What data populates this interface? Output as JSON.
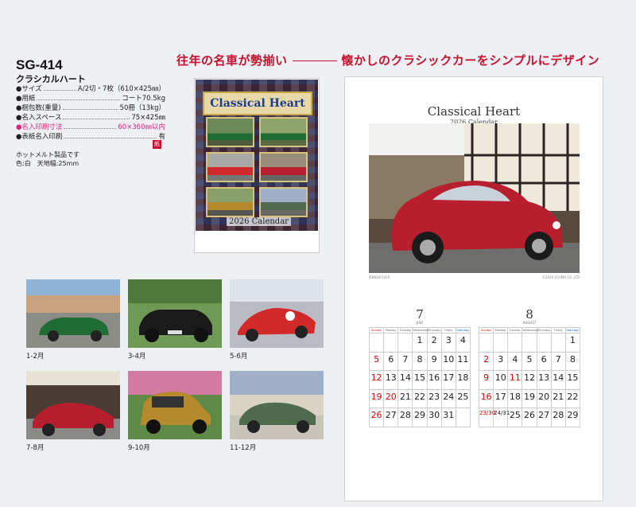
{
  "headline": {
    "left": "往年の名車が勢揃い",
    "right": "懐かしのクラシックカーをシンプルにデザイン"
  },
  "product": {
    "code": "SG-414",
    "name": "クラシカルハート",
    "specs": [
      {
        "label": "●サイズ",
        "value": "A/2切・7枚（610×425㎜）",
        "highlight": false
      },
      {
        "label": "●用紙",
        "value": "コート70.5kg",
        "highlight": false
      },
      {
        "label": "●梱包数(重量)",
        "value": "50冊（13kg）",
        "highlight": false
      },
      {
        "label": "●名入スペース",
        "value": "75×425㎜",
        "highlight": false
      },
      {
        "label": "●名入印刷寸法",
        "value": "60×360㎜以内",
        "highlight": true
      },
      {
        "label": "●表紙名入印刷",
        "value": "有",
        "highlight": false
      }
    ],
    "tag": "紙",
    "notes": [
      "ホットメルト製品です",
      "色:白　天地幅:25mm"
    ]
  },
  "cover": {
    "title": "Classical Heart",
    "year": "2026 Calendar"
  },
  "thumbnails": [
    {
      "label": "1-2月",
      "color": "#1f6d35"
    },
    {
      "label": "3-4月",
      "color": "#1a1a1a"
    },
    {
      "label": "5-6月",
      "color": "#d22a2a"
    },
    {
      "label": "7-8月",
      "color": "#b81f2e"
    },
    {
      "label": "9-10月",
      "color": "#b48a2c"
    },
    {
      "label": "11-12月",
      "color": "#4f6a4d"
    }
  ],
  "calendar": {
    "title": "Classical Heart",
    "subtitle": "2026 Calendar",
    "photo_caption_left": "JENSEN 541R",
    "photo_caption_right": "©2026 ZUUMA CO.,LTD",
    "weekdays": [
      "Sunday",
      "Monday",
      "Tuesday",
      "Wednesday",
      "Thursday",
      "Friday",
      "Saturday"
    ],
    "months": [
      {
        "num": "7",
        "name": "JULY",
        "weeks": [
          [
            "",
            "",
            "",
            "1",
            "2",
            "3",
            "4"
          ],
          [
            "5",
            "6",
            "7",
            "8",
            "9",
            "10",
            "11"
          ],
          [
            "12",
            "13",
            "14",
            "15",
            "16",
            "17",
            "18"
          ],
          [
            "19",
            "20",
            "21",
            "22",
            "23",
            "24",
            "25"
          ],
          [
            "26",
            "27",
            "28",
            "29",
            "30",
            "31",
            ""
          ]
        ],
        "holidays": [
          "20"
        ]
      },
      {
        "num": "8",
        "name": "AUGUST",
        "weeks": [
          [
            "",
            "",
            "",
            "",
            "",
            "",
            "1"
          ],
          [
            "2",
            "3",
            "4",
            "5",
            "6",
            "7",
            "8"
          ],
          [
            "9",
            "10",
            "11",
            "12",
            "13",
            "14",
            "15"
          ],
          [
            "16",
            "17",
            "18",
            "19",
            "20",
            "21",
            "22"
          ],
          [
            "23/30",
            "24/31",
            "25",
            "26",
            "27",
            "28",
            "29"
          ]
        ],
        "holidays": [
          "11"
        ]
      }
    ]
  }
}
